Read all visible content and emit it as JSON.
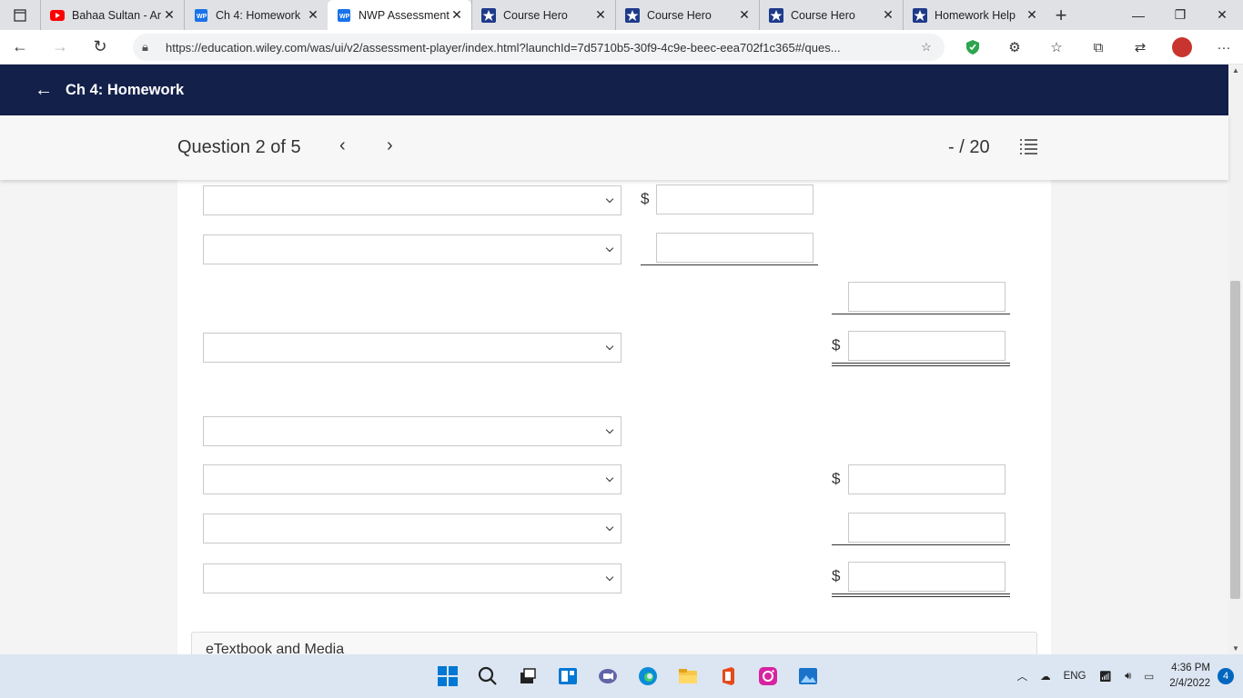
{
  "browser": {
    "tabs": [
      {
        "title": "Bahaa Sultan - Ar",
        "icon": "youtube-icon",
        "active": false
      },
      {
        "title": "Ch 4: Homework",
        "icon": "wileyplus-icon",
        "active": false
      },
      {
        "title": "NWP Assessment",
        "icon": "wileyplus-icon",
        "active": true
      },
      {
        "title": "Course Hero",
        "icon": "coursehero-icon",
        "active": false
      },
      {
        "title": "Course Hero",
        "icon": "coursehero-icon",
        "active": false
      },
      {
        "title": "Course Hero",
        "icon": "coursehero-icon",
        "active": false
      },
      {
        "title": "Homework Help",
        "icon": "coursehero-icon",
        "active": false
      }
    ],
    "url": "https://education.wiley.com/was/ui/v2/assessment-player/index.html?launchId=7d5710b5-30f9-4c9e-beec-eea702f1c365#/ques..."
  },
  "app": {
    "back_label": "Ch 4: Homework"
  },
  "question": {
    "label": "Question 2 of 5",
    "score": "- / 20"
  },
  "form": {
    "currency": "$"
  },
  "etextbook": {
    "label": "eTextbook and Media"
  },
  "taskbar": {
    "lang": "ENG",
    "time": "4:36 PM",
    "date": "2/4/2022",
    "notifications": "4"
  },
  "colors": {
    "header_bg": "#13204a",
    "accent": "#0067c0"
  }
}
